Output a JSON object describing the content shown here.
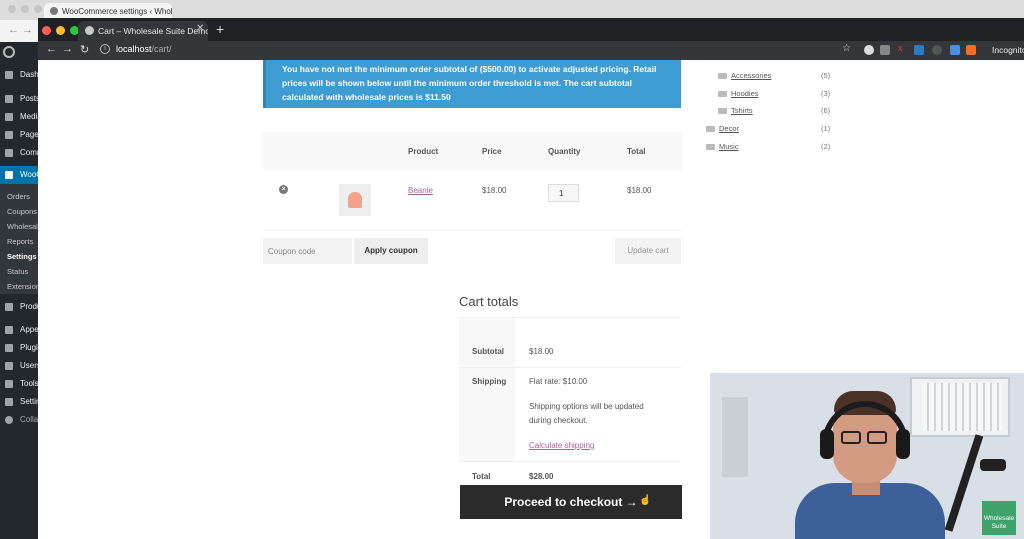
{
  "back_window": {
    "tab_title": "WooCommerce settings ‹ Wholesale",
    "admin_menu": {
      "top_items": [
        "Dashboard",
        "Posts",
        "Media",
        "Pages",
        "Comments",
        "WooCommerce"
      ],
      "sub_items": [
        "Orders",
        "Coupons",
        "Wholesale",
        "Reports",
        "Settings",
        "Status",
        "Extensions"
      ],
      "bottom_items": [
        "Products",
        "Appearance",
        "Plugins",
        "Users",
        "Tools",
        "Settings",
        "Collapse menu"
      ]
    }
  },
  "browser": {
    "tab_title": "Cart – Wholesale Suite Demo",
    "url_host": "localhost",
    "url_path": "/cart/",
    "profile_label": "Incognito"
  },
  "notice": {
    "text": "You have not met the minimum order subtotal of ($500.00) to activate adjusted pricing. Retail prices will be shown below until the minimum order threshold is met. The cart subtotal calculated with wholesale prices is $11.50"
  },
  "cart_table": {
    "headers": {
      "product": "Product",
      "price": "Price",
      "quantity": "Quantity",
      "total": "Total"
    },
    "rows": [
      {
        "product": "Beanie",
        "price": "$18.00",
        "quantity": "1",
        "total": "$18.00"
      }
    ],
    "remove_glyph": "×"
  },
  "coupon": {
    "placeholder": "Coupon code",
    "apply_label": "Apply coupon",
    "update_label": "Update cart"
  },
  "totals": {
    "title": "Cart totals",
    "subtotal_label": "Subtotal",
    "subtotal_value": "$18.00",
    "shipping_label": "Shipping",
    "shipping_value": "Flat rate: $10.00",
    "shipping_note_1": "Shipping options will be updated",
    "shipping_note_2": "during checkout.",
    "calc_shipping_link": "Calculate shipping",
    "total_label": "Total",
    "total_value": "$28.00",
    "checkout_label": "Proceed to checkout →"
  },
  "categories": [
    {
      "name": "Accessories",
      "count": "(5)",
      "indent": true
    },
    {
      "name": "Hoodies",
      "count": "(3)",
      "indent": true
    },
    {
      "name": "Tshirts",
      "count": "(6)",
      "indent": true
    },
    {
      "name": "Decor",
      "count": "(1)",
      "indent": false
    },
    {
      "name": "Music",
      "count": "(2)",
      "indent": false
    }
  ],
  "webcam": {
    "brand_line_1": "Wholesale",
    "brand_line_2": "Suite"
  },
  "colors": {
    "notice_bg": "#3d9cd2",
    "link": "#a46497",
    "checkout_bg": "#2b2b2b",
    "wp_sidebar": "#23282d",
    "wp_active": "#0073aa"
  }
}
